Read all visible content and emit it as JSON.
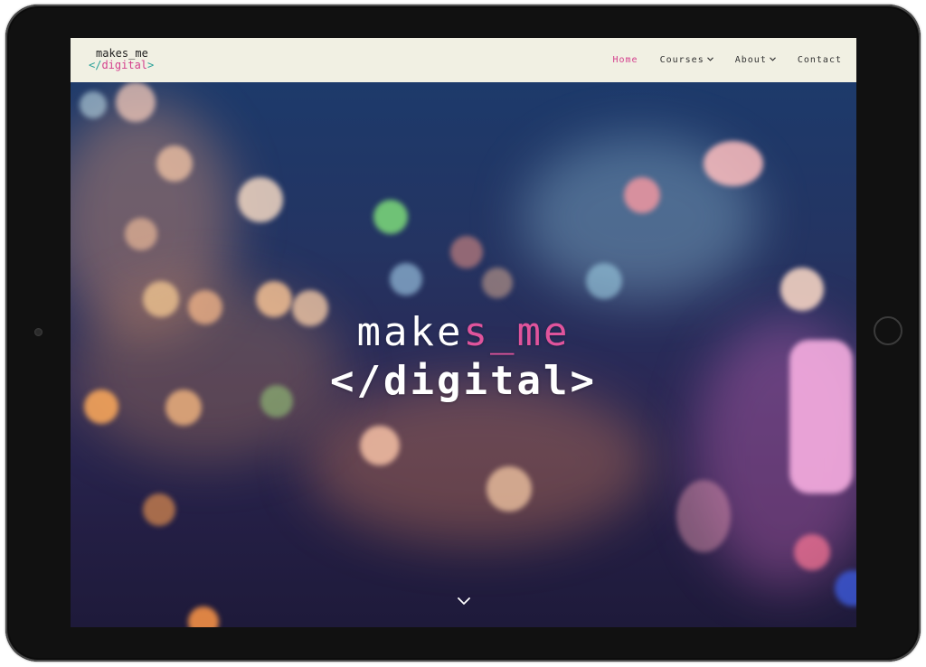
{
  "brand": {
    "logo_line1": "makes_me",
    "logo_open": "</",
    "logo_word": "digital",
    "logo_close": ">"
  },
  "nav": {
    "items": [
      {
        "label": "Home",
        "active": true
      },
      {
        "label": "Courses",
        "dropdown": true
      },
      {
        "label": "About",
        "dropdown": true
      },
      {
        "label": "Contact"
      }
    ],
    "dropdown_icon": "chevron-down-icon"
  },
  "hero": {
    "title_white": "make",
    "title_pink": "s_me",
    "subtitle": "</digital>",
    "scroll_icon": "chevron-down-icon"
  },
  "colors": {
    "accent": "#d43f8d",
    "nav_bg": "#f1f0e3",
    "logo_bracket": "#2aa198"
  }
}
